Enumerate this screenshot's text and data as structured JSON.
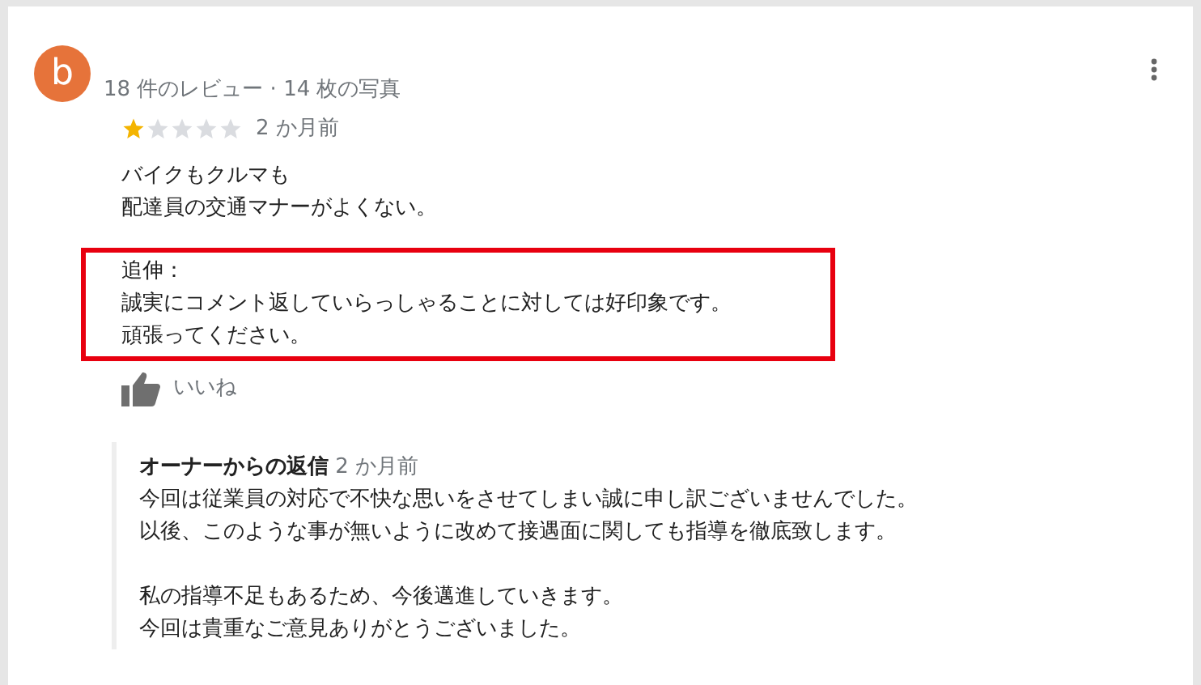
{
  "review": {
    "avatar_letter": "b",
    "meta": "18 件のレビュー · 14 枚の写真",
    "stars": 1,
    "time": "2 か月前",
    "paragraphs": [
      {
        "lines": [
          "バイクもクルマも",
          "配達員の交通マナーがよくない。"
        ],
        "highlighted": false
      },
      {
        "lines": [
          "追伸：",
          "誠実にコメント返していらっしゃることに対しては好印象です。",
          "頑張ってください。"
        ],
        "highlighted": true
      }
    ],
    "like_label": "いいね",
    "owner_reply": {
      "title": "オーナーからの返信",
      "time": "2 か月前",
      "paragraphs": [
        [
          "今回は従業員の対応で不快な思いをさせてしまい誠に申し訳ございませんでした。",
          "以後、このような事が無いように改めて接遇面に関しても指導を徹底致します。"
        ],
        [
          "私の指導不足もあるため、今後邁進していきます。",
          "今回は貴重なご意見ありがとうございました。"
        ]
      ]
    }
  }
}
